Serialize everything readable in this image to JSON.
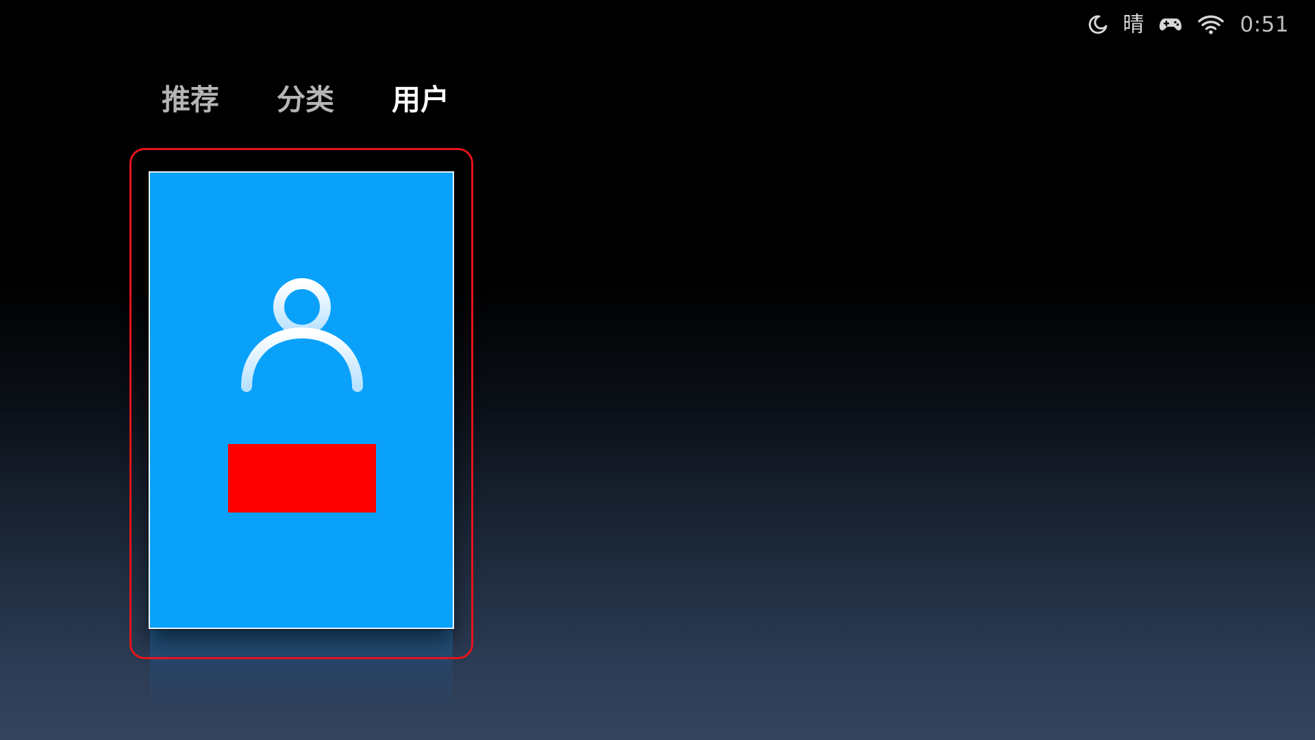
{
  "status_bar": {
    "icons": [
      "moon-icon",
      "gamepad-icon",
      "wifi-icon"
    ],
    "weather": "晴",
    "time": "0:51"
  },
  "nav": {
    "tabs": [
      {
        "label": "推荐",
        "active": false
      },
      {
        "label": "分类",
        "active": false
      },
      {
        "label": "用户",
        "active": true
      }
    ]
  },
  "user_card": {
    "icon": "user-avatar-icon",
    "background_color": "#0aa1fa",
    "label_redacted_color": "#ff0000"
  },
  "colors": {
    "focus_ring": "#e8131b",
    "card_blue": "#0aa1fa"
  }
}
